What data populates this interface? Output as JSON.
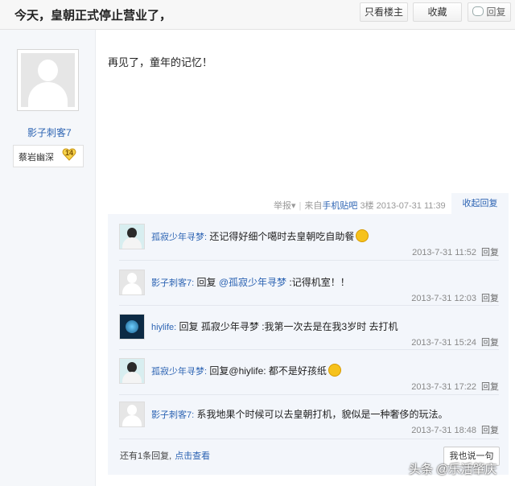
{
  "header": {
    "title": "今天，皇朝正式停止营业了，",
    "only_op_label": "只看楼主",
    "favorite_label": "收藏",
    "reply_label": "回复"
  },
  "post": {
    "author": "影子刺客7",
    "badge_name": "蔡岩幽深",
    "badge_level": "14",
    "content": "再见了，童年的记忆！",
    "report_label": "举报",
    "source_prefix": "来自",
    "source_link": "手机贴吧",
    "floor": "3楼",
    "time": "2013-07-31 11:39",
    "fold_label": "收起回复"
  },
  "replies": [
    {
      "name": "孤寂少年寻梦:",
      "text": "还记得好细个噶时去皇朝吃自助餐",
      "time": "2013-7-31 11:52",
      "reply": "回复",
      "avatar": "anime",
      "emoji": true
    },
    {
      "name": "影子刺客7:",
      "text_prefix": "回复 ",
      "mention": "@孤寂少年寻梦",
      "text": ":记得机室！！",
      "time": "2013-7-31 12:03",
      "reply": "回复",
      "avatar": "default"
    },
    {
      "name": "hiylife:",
      "text": "回复 孤寂少年寻梦 :我第一次去是在我3岁时 去打机",
      "time": "2013-7-31 15:24",
      "reply": "回复",
      "avatar": "dark"
    },
    {
      "name": "孤寂少年寻梦:",
      "text": "回复@hiylife:  都不是好孩纸",
      "time": "2013-7-31 17:22",
      "reply": "回复",
      "avatar": "anime",
      "emoji": true
    },
    {
      "name": "影子刺客7:",
      "text": "系我地果个时候可以去皇朝打机，貌似是一种奢侈的玩法。",
      "time": "2013-7-31 18:48",
      "reply": "回复",
      "avatar": "default"
    }
  ],
  "more": {
    "text": "还有1条回复,",
    "link": "点击查看",
    "say_button": "我也说一句"
  },
  "watermark": "头条 @乐活肇庆"
}
